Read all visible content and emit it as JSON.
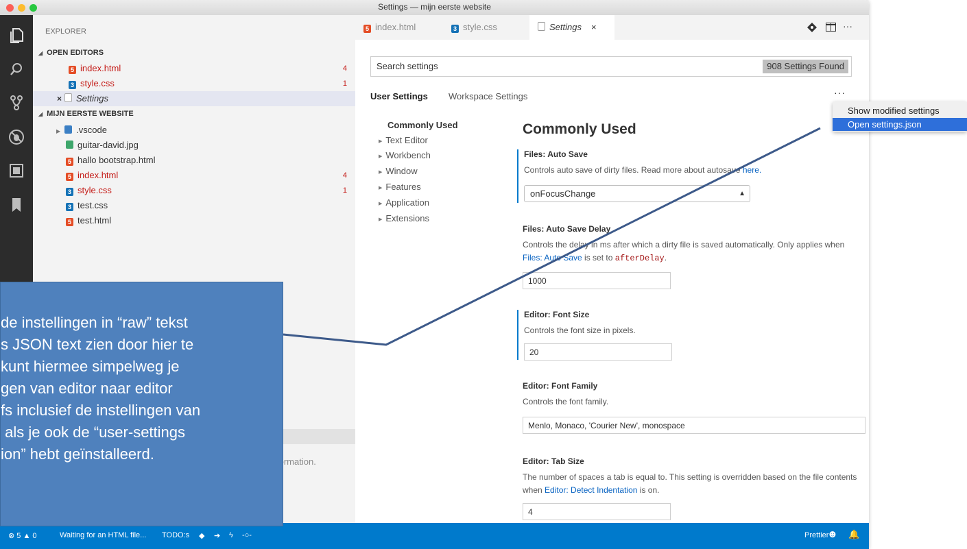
{
  "window": {
    "title": "Settings — mijn eerste website"
  },
  "activity_bar": {
    "icons": [
      "explorer-icon",
      "search-icon",
      "source-control-icon",
      "debug-icon",
      "extensions-icon",
      "bookmark-icon"
    ]
  },
  "explorer": {
    "title": "EXPLORER",
    "open_editors": {
      "header": "OPEN EDITORS",
      "items": [
        {
          "label": "index.html",
          "badge": "4"
        },
        {
          "label": "style.css",
          "badge": "1"
        },
        {
          "label": "Settings",
          "badge": ""
        }
      ]
    },
    "project": {
      "header": "MIJN EERSTE WEBSITE",
      "items": [
        {
          "label": ".vscode",
          "badge": ""
        },
        {
          "label": "guitar-david.jpg",
          "badge": ""
        },
        {
          "label": "hallo bootstrap.html",
          "badge": ""
        },
        {
          "label": "index.html",
          "badge": "4"
        },
        {
          "label": "style.css",
          "badge": "1"
        },
        {
          "label": "test.css",
          "badge": ""
        },
        {
          "label": "test.html",
          "badge": ""
        }
      ]
    },
    "outline_text": "formation."
  },
  "tabs": [
    {
      "label": "index.html"
    },
    {
      "label": "style.css"
    },
    {
      "label": "Settings",
      "close": "×"
    }
  ],
  "tabbar_actions": {
    "more": "···"
  },
  "settings": {
    "search_placeholder": "Search settings",
    "found_count": "908 Settings Found",
    "scope_tabs": {
      "user": "User Settings",
      "workspace": "Workspace Settings"
    },
    "more": "···",
    "toc": [
      "Commonly Used",
      "Text Editor",
      "Workbench",
      "Window",
      "Features",
      "Application",
      "Extensions"
    ],
    "section_title": "Commonly Used",
    "auto_save": {
      "title": "Files: Auto Save",
      "desc": "Controls auto save of dirty files. Read more about autosave ",
      "link": "here.",
      "value": "onFocusChange"
    },
    "auto_save_delay": {
      "title": "Files: Auto Save Delay",
      "desc1": "Controls the delay in ms after which a dirty file is saved automatically. Only applies when ",
      "link": "Files: Auto Save",
      "desc2": " is set to ",
      "code": "afterDelay",
      "desc3": ".",
      "value": "1000"
    },
    "font_size": {
      "title": "Editor: Font Size",
      "desc": "Controls the font size in pixels.",
      "value": "20"
    },
    "font_family": {
      "title": "Editor: Font Family",
      "desc": "Controls the font family.",
      "value": "Menlo, Monaco, 'Courier New', monospace"
    },
    "tab_size": {
      "title": "Editor: Tab Size",
      "desc1": "The number of spaces a tab is equal to. This setting is overridden based on the file contents when ",
      "link": "Editor: Detect Indentation",
      "desc2": " is on.",
      "value": "4"
    }
  },
  "context_menu": {
    "items": [
      "Show modified settings",
      "Open settings.json"
    ],
    "selected_index": 1
  },
  "status_bar": {
    "errors": "5",
    "warnings": "0",
    "message": "Waiting for an HTML file...",
    "todos": "TODO:s",
    "prettier": "Prettier"
  },
  "callout": {
    "text": "de instellingen in “raw” tekst\ns JSON text zien door hier te\nkunt hiermee simpelweg je\ngen van editor naar editor\nfs inclusief de instellingen van\n als je ook de “user-settings\nion” hebt geïnstalleerd."
  },
  "colors": {
    "accent": "#007acc",
    "callout_fill": "#4f81bd",
    "pointer_line": "#3d5a8a",
    "menu_selected": "#2e6fda",
    "error_badge": "#c41a16"
  }
}
